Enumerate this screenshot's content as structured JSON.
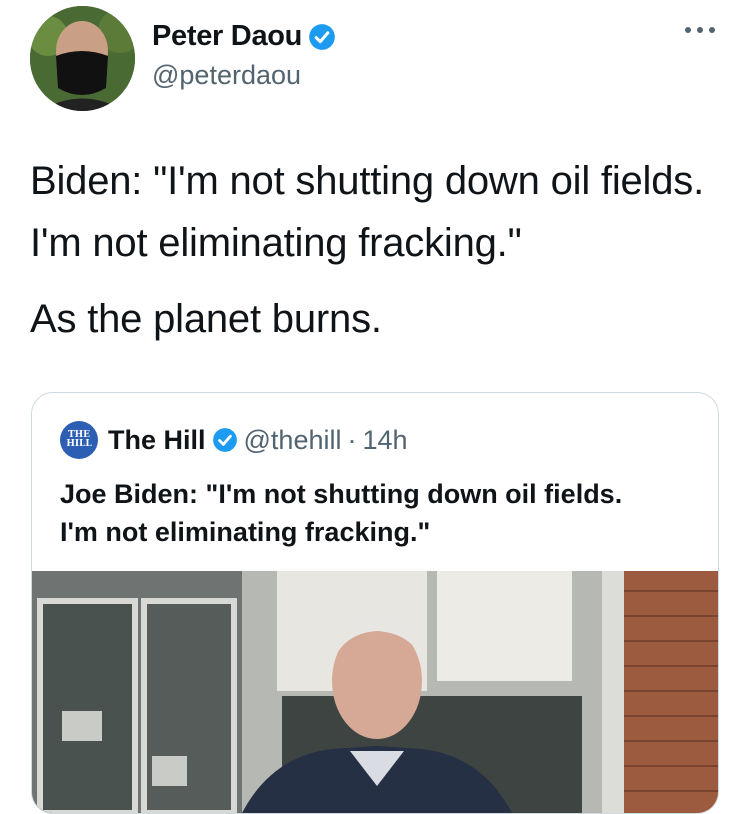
{
  "author": {
    "name": "Peter Daou",
    "handle": "@peterdaou"
  },
  "tweet": {
    "text_line1": "Biden: \"I'm not shutting down oil fields. I'm not eliminating fracking.\"",
    "text_line2": "As the planet burns."
  },
  "quoted_tweet": {
    "avatar_text_top": "THE",
    "avatar_text_bottom": "HILL",
    "name": "The Hill",
    "handle": "@thehill",
    "separator": "·",
    "time": "14h",
    "text_line1": "Joe Biden: \"I'm not shutting down oil fields.",
    "text_line2": "I'm not eliminating fracking.\""
  },
  "colors": {
    "verified": "#1d9bf0",
    "handle_gray": "#536471",
    "border": "#cfd9de",
    "hill_blue": "#2c5fb3"
  },
  "icons": [
    "verified-badge-icon",
    "more-options-icon"
  ]
}
